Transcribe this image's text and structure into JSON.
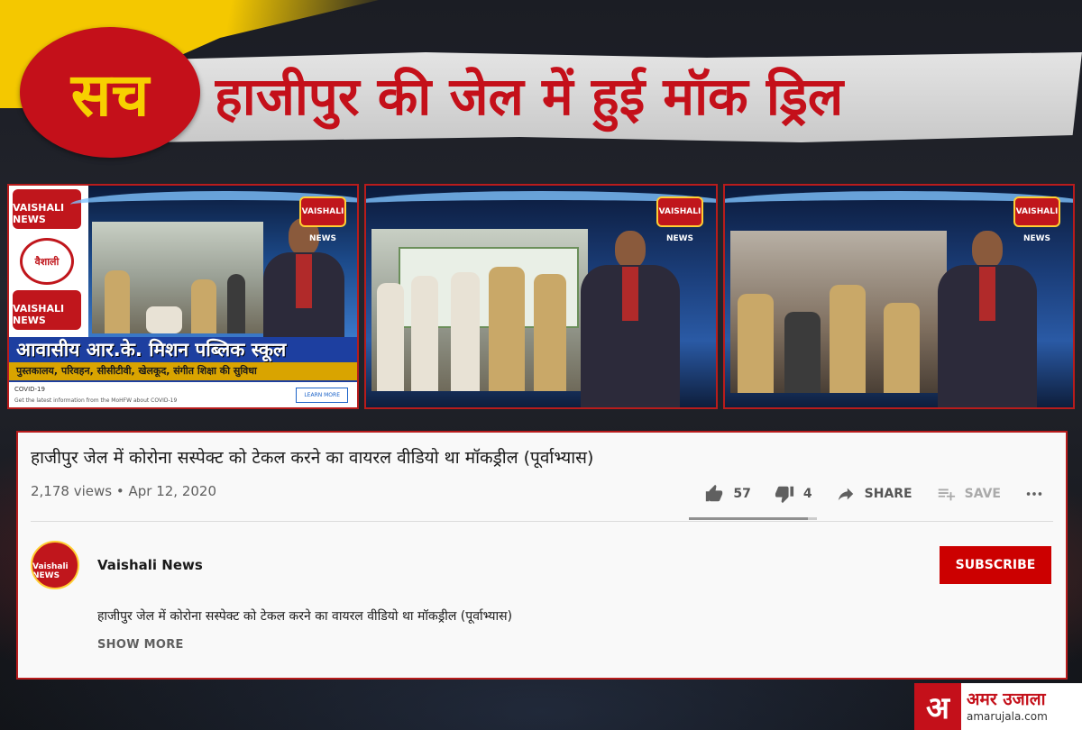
{
  "banner": {
    "badge": "सच",
    "headline": "हाजीपुर की जेल में हुई मॉक ड्रिल"
  },
  "thumbnails": {
    "channel_logo_text": "VAISHALI NEWS",
    "side_logo_mid": "वैशाली",
    "school_title": "आवासीय आर.के. मिशन पब्लिक स्कूल",
    "school_sub": "पुस्तकालय, परिवहन, सीसीटीवी, खेलकूद, संगीत शिक्षा की सुविधा",
    "covid_title": "COVID-19",
    "covid_desc": "Get the latest information from the MoHFW about COVID-19",
    "learn_more": "LEARN MORE"
  },
  "video": {
    "title": "हाजीपुर जेल में कोरोना सस्पेक्ट को टेकल करने का वायरल वीडियो था मॉकड्रील (पूर्वाभ्यास)",
    "views": "2,178 views",
    "separator": "•",
    "date": "Apr 12, 2020",
    "likes": "57",
    "dislikes": "4",
    "share_label": "SHARE",
    "save_label": "SAVE",
    "like_ratio": 0.93
  },
  "channel": {
    "name": "Vaishali News",
    "avatar_text": "Vaishali NEWS",
    "subscribe_label": "SUBSCRIBE"
  },
  "description": {
    "text": "हाजीपुर जेल में कोरोना सस्पेक्ट को टेकल करने का वायरल वीडियो था मॉकड्रील (पूर्वाभ्यास)",
    "show_more": "SHOW MORE"
  },
  "brand": {
    "mark": "अ",
    "name": "अमर उजाला",
    "url": "amarujala.com"
  },
  "colors": {
    "accent_red": "#c4101a",
    "badge_yellow": "#f7d000",
    "subscribe_red": "#cc0000"
  }
}
